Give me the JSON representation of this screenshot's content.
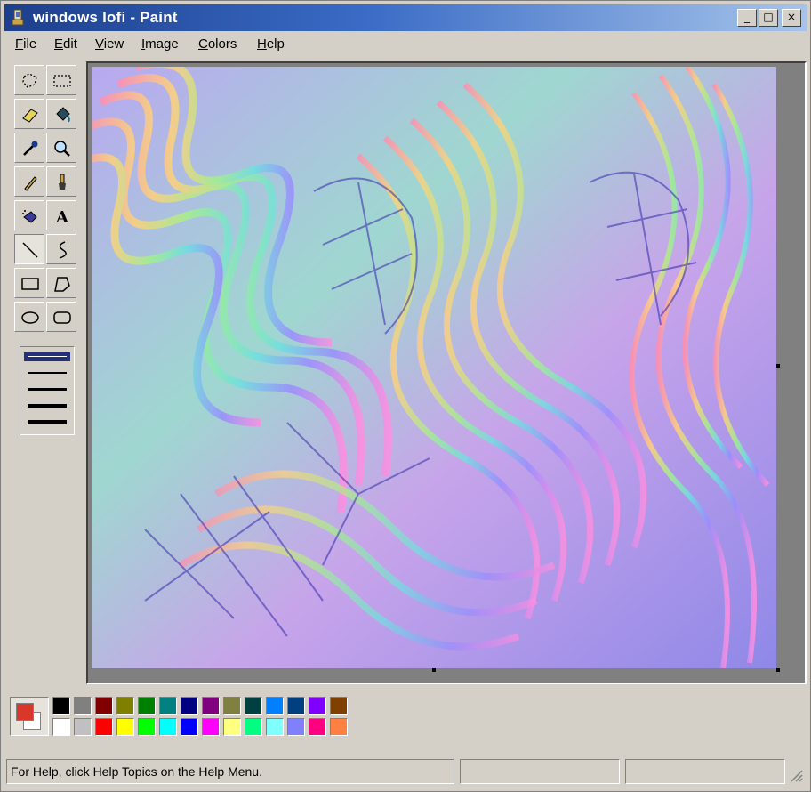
{
  "window": {
    "title": "windows lofi - Paint",
    "controls": {
      "minimize": "_",
      "maximize": "□",
      "close": "×"
    }
  },
  "menubar": {
    "items": [
      {
        "label": "File",
        "underline": "F",
        "rest": "ile"
      },
      {
        "label": "Edit",
        "underline": "E",
        "rest": "dit"
      },
      {
        "label": "View",
        "underline": "V",
        "rest": "iew"
      },
      {
        "label": "Image",
        "underline": "I",
        "rest": "mage"
      },
      {
        "label": "Colors",
        "underline": "C",
        "rest": "olors"
      },
      {
        "label": "Help",
        "underline": "H",
        "rest": "elp"
      }
    ]
  },
  "toolbox": {
    "tools": [
      "free-form-select-icon",
      "select-icon",
      "eraser-icon",
      "fill-bucket-icon",
      "pick-color-icon",
      "magnifier-icon",
      "pencil-icon",
      "brush-icon",
      "airbrush-icon",
      "text-icon",
      "line-icon",
      "curve-icon",
      "rectangle-icon",
      "polygon-icon",
      "ellipse-icon",
      "rounded-rectangle-icon"
    ],
    "active_tool": "line-icon",
    "line_widths": [
      1,
      2,
      3,
      4,
      5
    ],
    "selected_line_width": 1
  },
  "colors": {
    "foreground": "#d8372a",
    "background": "#ffffff",
    "palette_top": [
      "#000000",
      "#808080",
      "#800000",
      "#808000",
      "#008000",
      "#008080",
      "#000080",
      "#800080",
      "#808040",
      "#004040",
      "#0080ff",
      "#004080",
      "#8000ff",
      "#804000"
    ],
    "palette_bottom": [
      "#ffffff",
      "#c0c0c0",
      "#ff0000",
      "#ffff00",
      "#00ff00",
      "#00ffff",
      "#0000ff",
      "#ff00ff",
      "#ffff80",
      "#00ff80",
      "#80ffff",
      "#8080ff",
      "#ff0080",
      "#ff8040"
    ]
  },
  "statusbar": {
    "help_text": "For Help, click Help Topics on the Help Menu.",
    "coords": "",
    "size": ""
  }
}
